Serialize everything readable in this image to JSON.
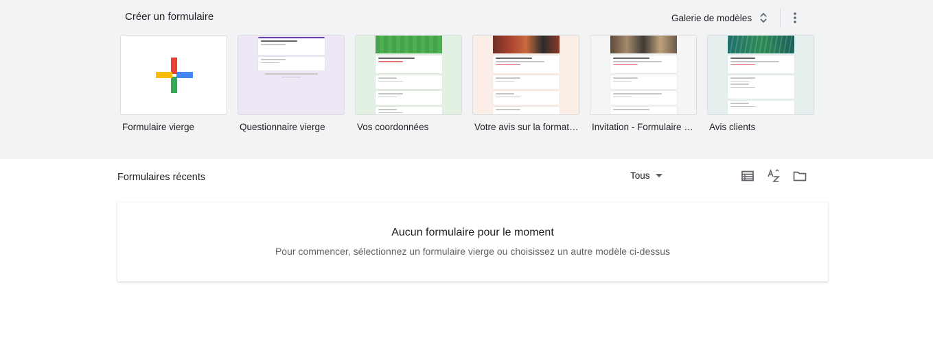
{
  "templates": {
    "title": "Créer un formulaire",
    "gallery_label": "Galerie de modèles",
    "items": [
      {
        "label": "Formulaire vierge",
        "thumb_bg": "#ffffff"
      },
      {
        "label": "Questionnaire vierge",
        "thumb_bg": "#ede7f6"
      },
      {
        "label": "Vos coordonnées",
        "thumb_bg": "#e3f1e2"
      },
      {
        "label": "Votre avis sur la formati…",
        "thumb_bg": "#fbeee7"
      },
      {
        "label": "Invitation - Formulaire …",
        "thumb_bg": "#f5f5f3"
      },
      {
        "label": "Avis clients",
        "thumb_bg": "#e6f1ef"
      }
    ]
  },
  "recent": {
    "title": "Formulaires récents",
    "filter_label": "Tous",
    "empty_title": "Aucun formulaire pour le moment",
    "empty_subtitle": "Pour commencer, sélectionnez un formulaire vierge ou choisissez un autre modèle ci-dessus"
  },
  "colors": {
    "plus_red": "#ea4335",
    "plus_blue": "#4285f4",
    "plus_green": "#34a853",
    "plus_yellow": "#fbbc04",
    "quiz_accent": "#673ab7"
  }
}
